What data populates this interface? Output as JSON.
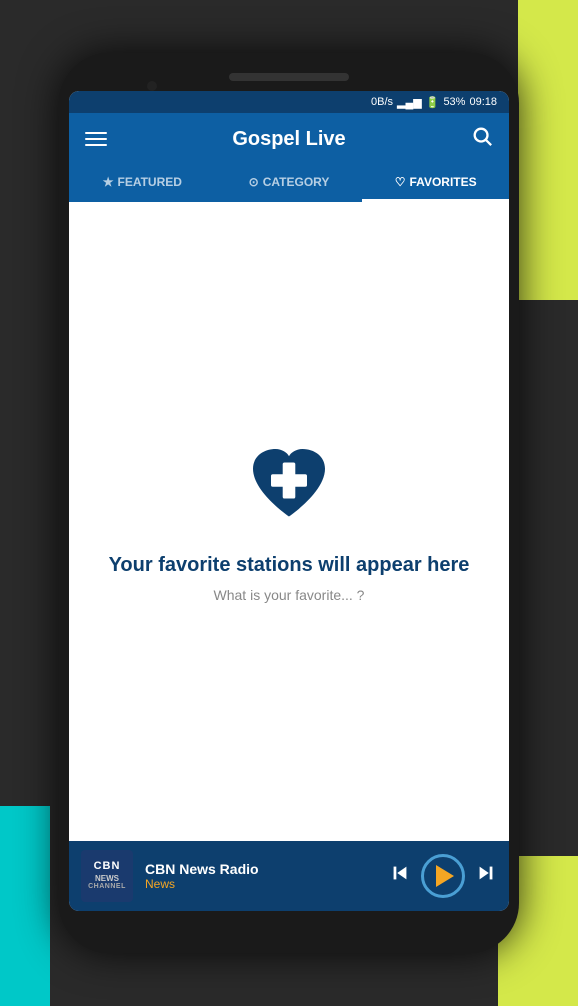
{
  "background": {
    "color": "#2a2a2a"
  },
  "status_bar": {
    "data_speed": "0B/s",
    "signal": "▂▄▆",
    "battery_percent": "53%",
    "time": "09:18"
  },
  "app_bar": {
    "title": "Gospel Live",
    "menu_icon": "hamburger",
    "search_icon": "search"
  },
  "tabs": [
    {
      "id": "featured",
      "label": "FEATURED",
      "icon": "★",
      "active": false
    },
    {
      "id": "category",
      "label": "CATEGORY",
      "icon": "⊙",
      "active": false
    },
    {
      "id": "favorites",
      "label": "FAVORITES",
      "icon": "♡",
      "active": true
    }
  ],
  "empty_state": {
    "icon": "heart-cross",
    "title": "Your favorite stations will appear here",
    "subtitle": "What is your favorite... ?"
  },
  "player": {
    "station_name": "CBN News Radio",
    "station_genre": "News",
    "logo_line1": "CBN",
    "logo_line2": "NEWS",
    "logo_line3": "CHANNEL",
    "controls": {
      "prev": "⏮",
      "play": "▶",
      "next": "⏭"
    }
  }
}
